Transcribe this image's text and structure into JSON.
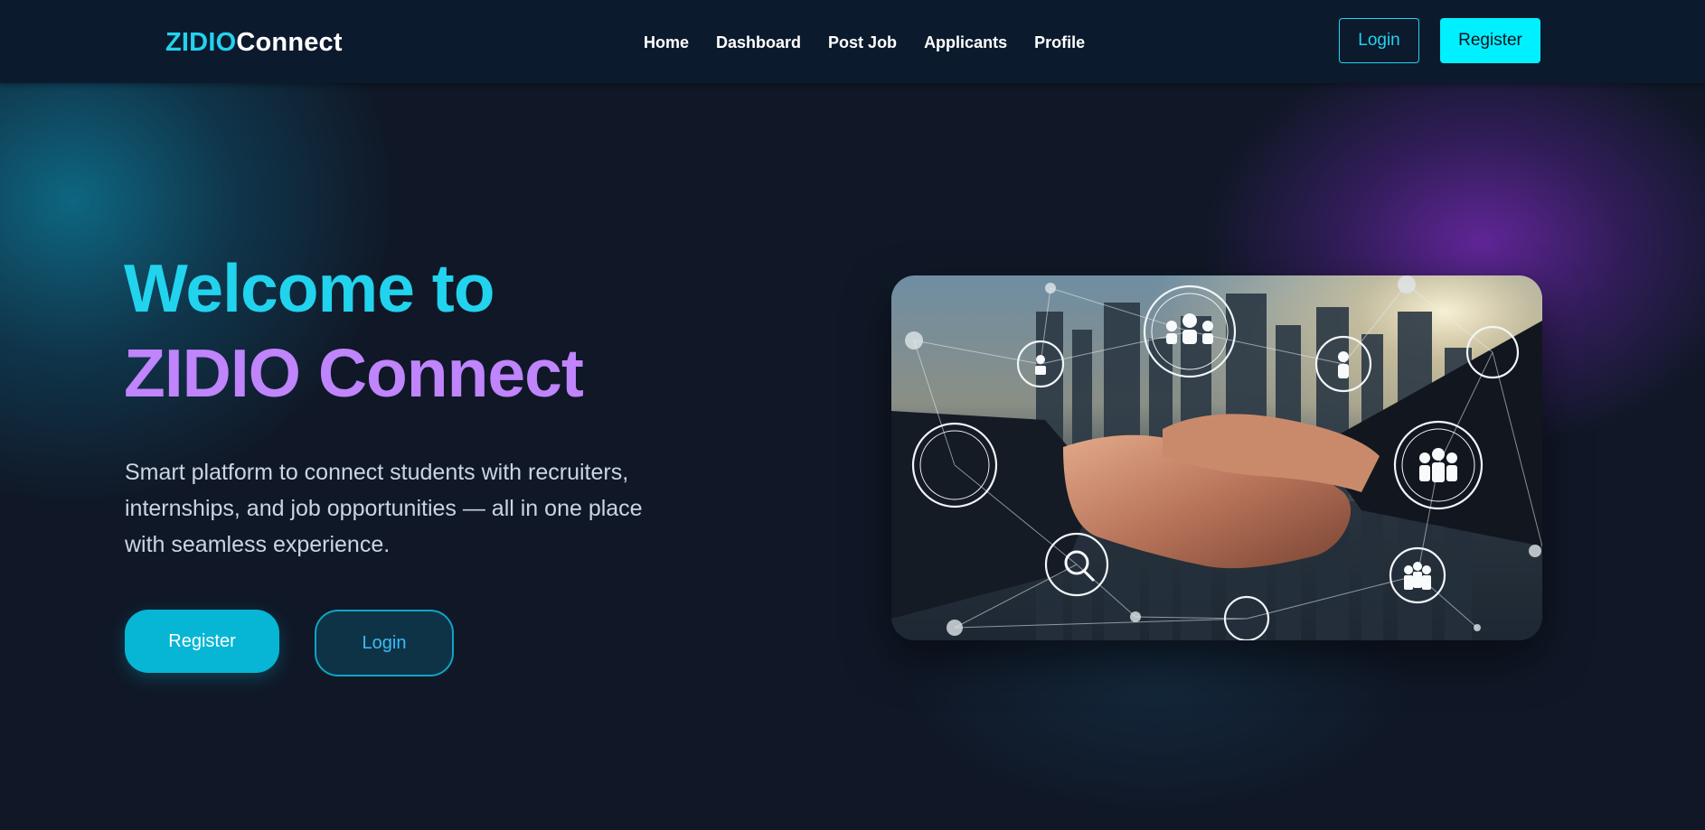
{
  "navbar": {
    "brand": {
      "part1": "ZIDIO",
      "part2": "Connect"
    },
    "links": [
      {
        "label": "Home"
      },
      {
        "label": "Dashboard"
      },
      {
        "label": "Post Job"
      },
      {
        "label": "Applicants"
      },
      {
        "label": "Profile"
      }
    ],
    "login_label": "Login",
    "register_label": "Register"
  },
  "hero": {
    "title_line1": "Welcome to",
    "title_line2": "ZIDIO Connect",
    "description": "Smart platform to connect students with recruiters, internships, and job opportunities — all in one place with seamless experience.",
    "register_label": "Register",
    "login_label": "Login",
    "image_icon": "handshake-network-illustration"
  },
  "colors": {
    "accent_cyan": "#22d3ee",
    "accent_purple": "#c084fc",
    "bright_cyan_button": "#00f0ff",
    "background": "#101827",
    "navbar": "#0c1a2e"
  }
}
